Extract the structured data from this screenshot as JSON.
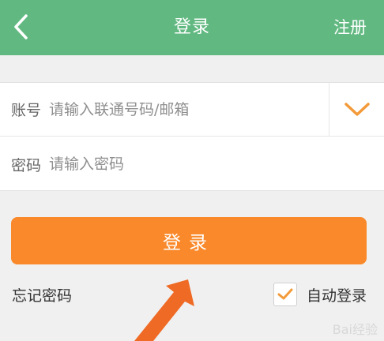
{
  "header": {
    "title": "登录",
    "register_label": "注册",
    "bg_color": "#61b981"
  },
  "form": {
    "account_label": "账号",
    "account_placeholder": "请输入联通号码/邮箱",
    "password_label": "密码",
    "password_placeholder": "请输入密码"
  },
  "actions": {
    "login_label": "登录",
    "forgot_label": "忘记密码",
    "auto_login_label": "自动登录",
    "auto_login_checked": true,
    "accent_color": "#f9892a"
  },
  "icons": {
    "back": "chevron-left-icon",
    "dropdown": "chevron-down-icon",
    "checkmark": "check-icon",
    "arrow": "pointer-arrow-icon"
  },
  "watermark": "Bai经验"
}
